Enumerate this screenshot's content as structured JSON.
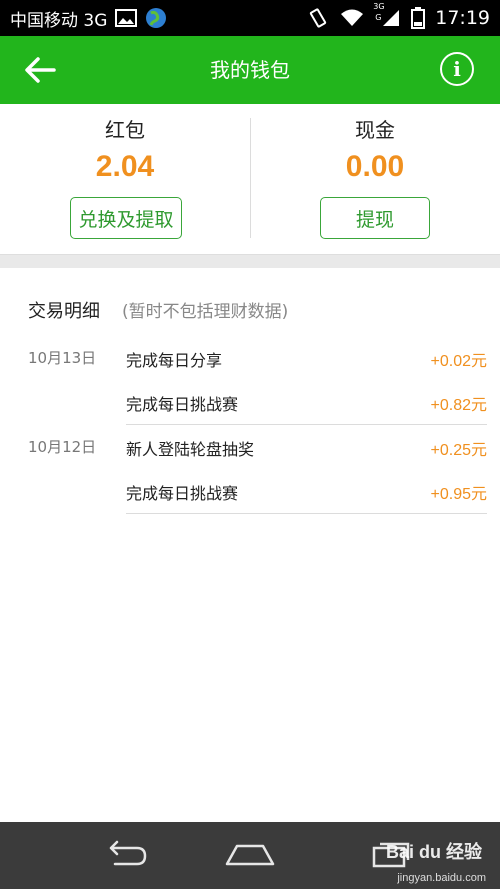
{
  "status_bar": {
    "carrier": "中国移动 3G",
    "network_tag": "3G",
    "network_tag_sub": "G",
    "time": "17:19"
  },
  "app_bar": {
    "title": "我的钱包",
    "info_label": "i"
  },
  "balances": {
    "red_packet": {
      "label": "红包",
      "value": "2.04",
      "button": "兑换及提取"
    },
    "cash": {
      "label": "现金",
      "value": "0.00",
      "button": "提现"
    }
  },
  "transactions": {
    "title": "交易明细",
    "note": "(暂时不包括理财数据)",
    "groups": [
      {
        "date": "10月13日",
        "items": [
          {
            "desc": "完成每日分享",
            "amount": "+0.02元"
          },
          {
            "desc": "完成每日挑战赛",
            "amount": "+0.82元"
          }
        ]
      },
      {
        "date": "10月12日",
        "items": [
          {
            "desc": "新人登陆轮盘抽奖",
            "amount": "+0.25元"
          },
          {
            "desc": "完成每日挑战赛",
            "amount": "+0.95元"
          }
        ]
      }
    ]
  },
  "watermark": {
    "brand": "Bai du 经验",
    "url": "jingyan.baidu.com"
  },
  "colors": {
    "accent_green": "#22b51c",
    "amount_orange": "#f0901f"
  }
}
